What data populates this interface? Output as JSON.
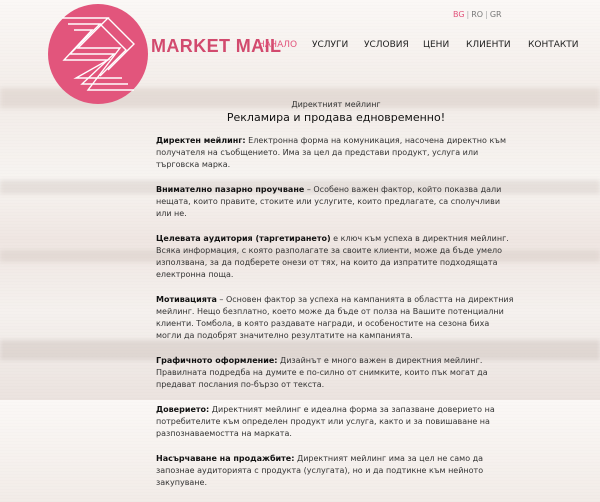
{
  "brand": {
    "name": "MARKET MAIL",
    "accent": "#e2557c"
  },
  "languages": [
    {
      "code": "BG",
      "active": true
    },
    {
      "code": "RO",
      "active": false
    },
    {
      "code": "GR",
      "active": false
    }
  ],
  "nav": [
    {
      "label": "НАЧАЛО",
      "active": true
    },
    {
      "label": "УСЛУГИ",
      "active": false
    },
    {
      "label": "УСЛОВИЯ",
      "active": false
    },
    {
      "label": "ЦЕНИ",
      "active": false
    },
    {
      "label": "КЛИЕНТИ",
      "active": false
    },
    {
      "label": "КОНТАКТИ",
      "active": false
    }
  ],
  "main": {
    "subtitle": "Директният мейлинг",
    "headline": "Рекламира и продава едновременно!",
    "paragraphs": [
      {
        "term": "Директен мейлинг:",
        "text": " Електронна форма на комуникация, насочена директно към получателя на съобщението. Има за цел да представи продукт, услуга или търговска марка."
      },
      {
        "term": "Внимателно пазарно проучване",
        "text": " – Особено важен фактор, който показва дали нещата, които правите, стоките или услугите, които предлагате, са сполучливи или не."
      },
      {
        "term": "Целевата аудитория (таргетирането)",
        "text": " е ключ към успеха в директния мейлинг. Всяка информация, с която разполагате за своите клиенти, може да бъде умело използвана, за да подберете онези от тях, на които да изпратите подходящата електронна поща."
      },
      {
        "term": "Мотивацията",
        "text": " – Основен фактор за успеха на кампанията в областта на директния мейлинг. Нещо безплатно, което може да бъде от полза на Вашите потенциални клиенти. Томбола, в която раздавате награди, и особеностите на сезона биха могли да подобрят значително резултатите на кампанията."
      },
      {
        "term": "Графичното оформление:",
        "text": " Дизайнът е много важен в директния мейлинг. Правилната подредба на думите е по-силно от снимките, които пък могат да предават послания по-бързо от текста."
      },
      {
        "term": "Доверието:",
        "text": " Директният мейлинг е идеална форма за запазване доверието на потребителите към определен продукт или услуга, както и за повишаване на разпознаваемостта на марката."
      },
      {
        "term": "Насърчаване на продажбите:",
        "text": " Директният мейлинг има за цел не само да запознае аудиторията с продукта (услугата), но и да подтикне към нейното закупуване."
      }
    ]
  }
}
